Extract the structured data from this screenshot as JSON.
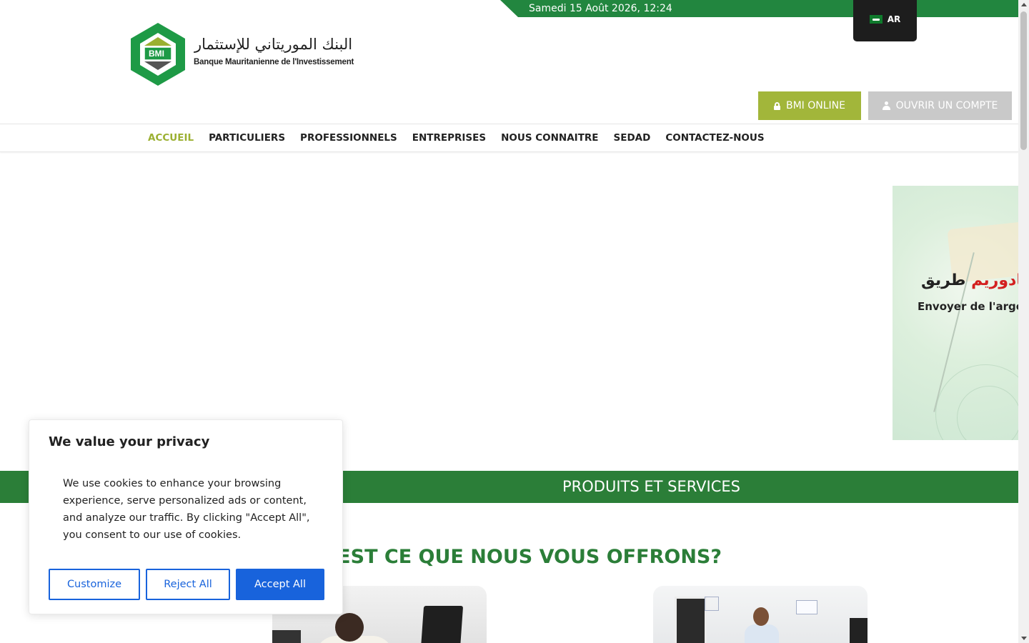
{
  "topbar": {
    "datetime": "Samedi 15 Août 2026, 12:24"
  },
  "language": {
    "label": "AR",
    "flag_icon": "saudi-flag-icon"
  },
  "logo": {
    "badge": "BMI",
    "arabic_name": "البنك الموريتاني للإستثمار",
    "french_name": "Banque Mauritanienne de l'Investissement"
  },
  "actions": {
    "online_label": "BMI ONLINE",
    "online_icon": "lock-icon",
    "account_label": "OUVRIR UN COMPTE",
    "account_icon": "user-icon"
  },
  "nav": {
    "items": [
      {
        "label": "ACCUEIL",
        "active": true
      },
      {
        "label": "PARTICULIERS",
        "active": false
      },
      {
        "label": "PROFESSIONNELS",
        "active": false
      },
      {
        "label": "ENTREPRISES",
        "active": false
      },
      {
        "label": "NOUS CONNAITRE",
        "active": false
      },
      {
        "label": "SEDAD",
        "active": false
      },
      {
        "label": "CONTACTEZ-NOUS",
        "active": false
      }
    ]
  },
  "slide": {
    "arabic_prefix": "طريق",
    "arabic_highlight": "كادوريم",
    "french_text": "Envoyer de l'arge"
  },
  "products": {
    "band_title": "PRODUITS ET SERVICES",
    "offer_title": "U’EST CE QUE NOUS VOUS OFFRONS?"
  },
  "cookie": {
    "title": "We value your privacy",
    "text": "We use cookies to enhance your browsing experience, serve personalized ads or content, and analyze our traffic. By clicking \"Accept All\", you consent to our use of cookies.",
    "customize_label": "Customize",
    "reject_label": "Reject All",
    "accept_label": "Accept All"
  },
  "colors": {
    "brand_green": "#2b7e38",
    "topbar_green": "#22863f",
    "accent_olive": "#a2b63a",
    "cookie_blue": "#1863dc"
  }
}
